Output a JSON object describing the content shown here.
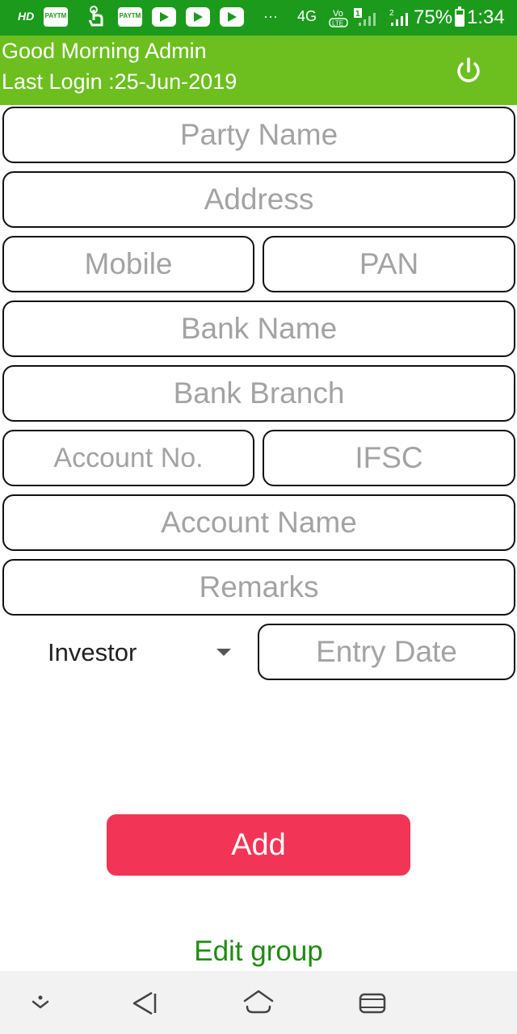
{
  "status_bar": {
    "hd": "HD",
    "app1": "PAYTM",
    "app2": "PAYTM",
    "more": "···",
    "network": "4G",
    "volte": "VoLTE",
    "sim1": "1",
    "sim2": "2",
    "battery": "75%",
    "battery_level": 0.75,
    "time": "1:34"
  },
  "header": {
    "greeting": "Good Morning Admin",
    "last_login": "Last Login :25-Jun-2019",
    "color": "#6cbf1e"
  },
  "form": {
    "party_name": "Party Name",
    "address": "Address",
    "mobile": "Mobile",
    "pan": "PAN",
    "bank_name": "Bank Name",
    "bank_branch": "Bank Branch",
    "account_no": "Account No.",
    "ifsc": "IFSC",
    "account_name": "Account Name",
    "remarks": "Remarks",
    "type_selected": "Investor",
    "entry_date": "Entry Date"
  },
  "actions": {
    "add_label": "Add",
    "add_color": "#f23556",
    "edit_group": "Edit group",
    "edit_group_color": "#1f8a12"
  },
  "nav": {
    "icons": [
      "chevron-down-icon",
      "back-icon",
      "home-icon",
      "recents-icon"
    ]
  }
}
